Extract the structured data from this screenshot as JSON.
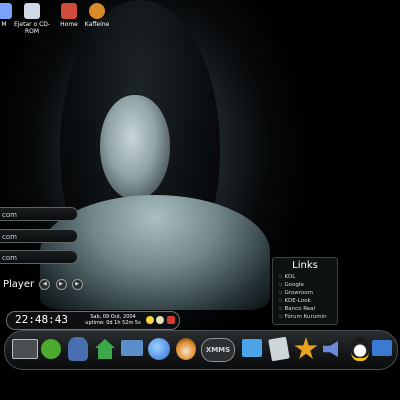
{
  "desktop_icons": [
    {
      "label": "M",
      "icon": "monitor-icon",
      "color": "#7aa2ff"
    },
    {
      "label": "Ejetar o CD-ROM",
      "icon": "eject-icon",
      "color": "#cfd8e6"
    },
    {
      "label": "Home",
      "icon": "home-icon",
      "color": "#d04c3a"
    },
    {
      "label": "Kaffeine",
      "icon": "kaffeine-icon",
      "color": "#d68a2a"
    }
  ],
  "side_panes": [
    {
      "text": "com"
    },
    {
      "text": "com"
    },
    {
      "text": "com"
    }
  ],
  "player": {
    "label": "Player",
    "buttons": [
      "prev",
      "play",
      "next"
    ]
  },
  "clock": {
    "time": "22:48:43",
    "date": "Sab, 09 Out, 2004",
    "uptime": "uptime: 0d 1h 52m 5s"
  },
  "links": {
    "title": "Links",
    "items": [
      ":: KDL",
      ":: Google",
      ":: Growroom",
      ":: KDE-Look",
      ":: Banco Real",
      ":: Fórum Kurumin"
    ]
  },
  "dock": {
    "items": [
      {
        "name": "terminal-icon",
        "color": "#4b4f52"
      },
      {
        "name": "icq-flower-icon",
        "color": "#4caa2c"
      },
      {
        "name": "avatar-icon",
        "color": "#4a6fb0"
      },
      {
        "name": "home-icon",
        "color": "#3ca84a"
      },
      {
        "name": "network-icon",
        "color": "#5a8ec8"
      },
      {
        "name": "browser-icon",
        "color": "#2f6fd8"
      },
      {
        "name": "penguin-icon",
        "color": "#e08c2a"
      },
      {
        "name": "xmms-icon",
        "color": "#d9d9d9",
        "label": "XMMS"
      },
      {
        "name": "monitor-icon",
        "color": "#4ba3e8"
      },
      {
        "name": "editor-icon",
        "color": "#cfd6da"
      },
      {
        "name": "star-icon",
        "color": "#e8a21b"
      },
      {
        "name": "speaker-icon",
        "color": "#6b8bd6"
      },
      {
        "name": "tux-icon",
        "color": "#f0c419"
      },
      {
        "name": "video-icon",
        "color": "#3b7ad0"
      }
    ]
  }
}
